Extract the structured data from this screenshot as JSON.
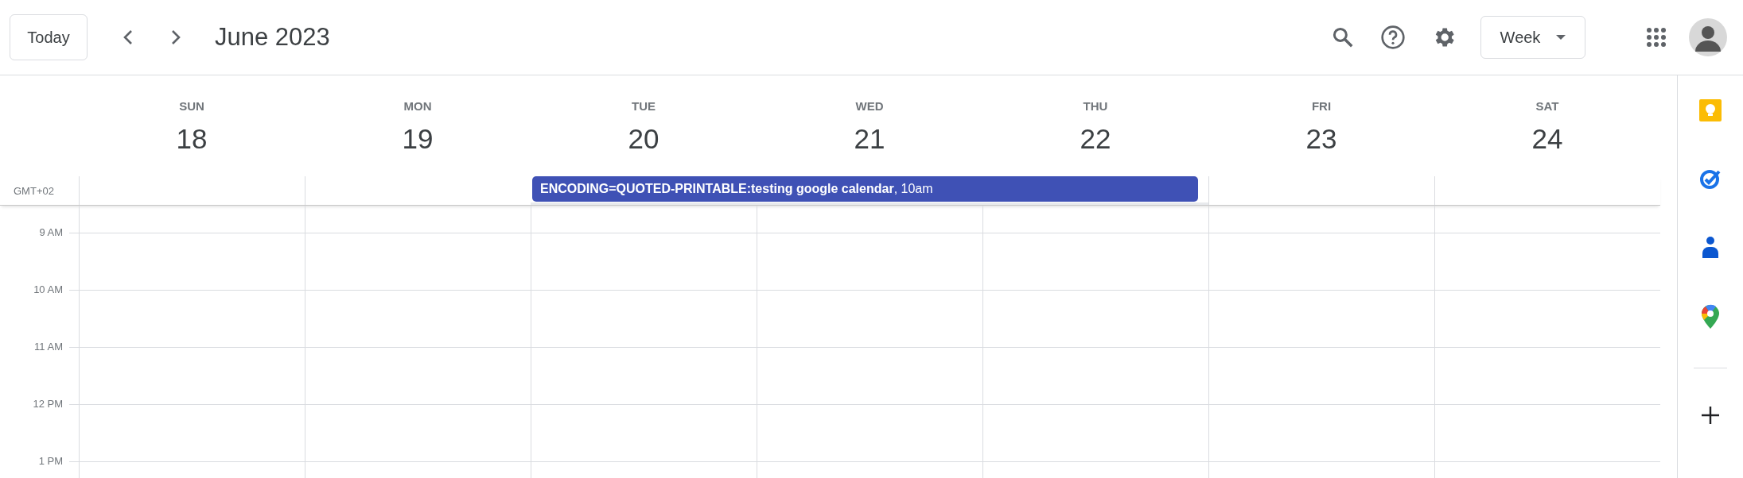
{
  "top_bar": {
    "today_button": "Today",
    "title": "June 2023",
    "view_dropdown": "Week"
  },
  "days": [
    {
      "name": "SUN",
      "number": "18",
      "in_event": false
    },
    {
      "name": "MON",
      "number": "19",
      "in_event": false
    },
    {
      "name": "TUE",
      "number": "20",
      "in_event": true
    },
    {
      "name": "WED",
      "number": "21",
      "in_event": true
    },
    {
      "name": "THU",
      "number": "22",
      "in_event": true
    },
    {
      "name": "FRI",
      "number": "23",
      "in_event": false
    },
    {
      "name": "SAT",
      "number": "24",
      "in_event": false
    }
  ],
  "timezone": "GMT+02",
  "event": {
    "title": "**ENCODING=QUOTED-PRINTABLE:testing google calendar**, 10am",
    "color": "#3f51b5"
  },
  "hours": [
    "9 AM",
    "10 AM",
    "11 AM",
    "12 PM",
    "1 PM"
  ]
}
